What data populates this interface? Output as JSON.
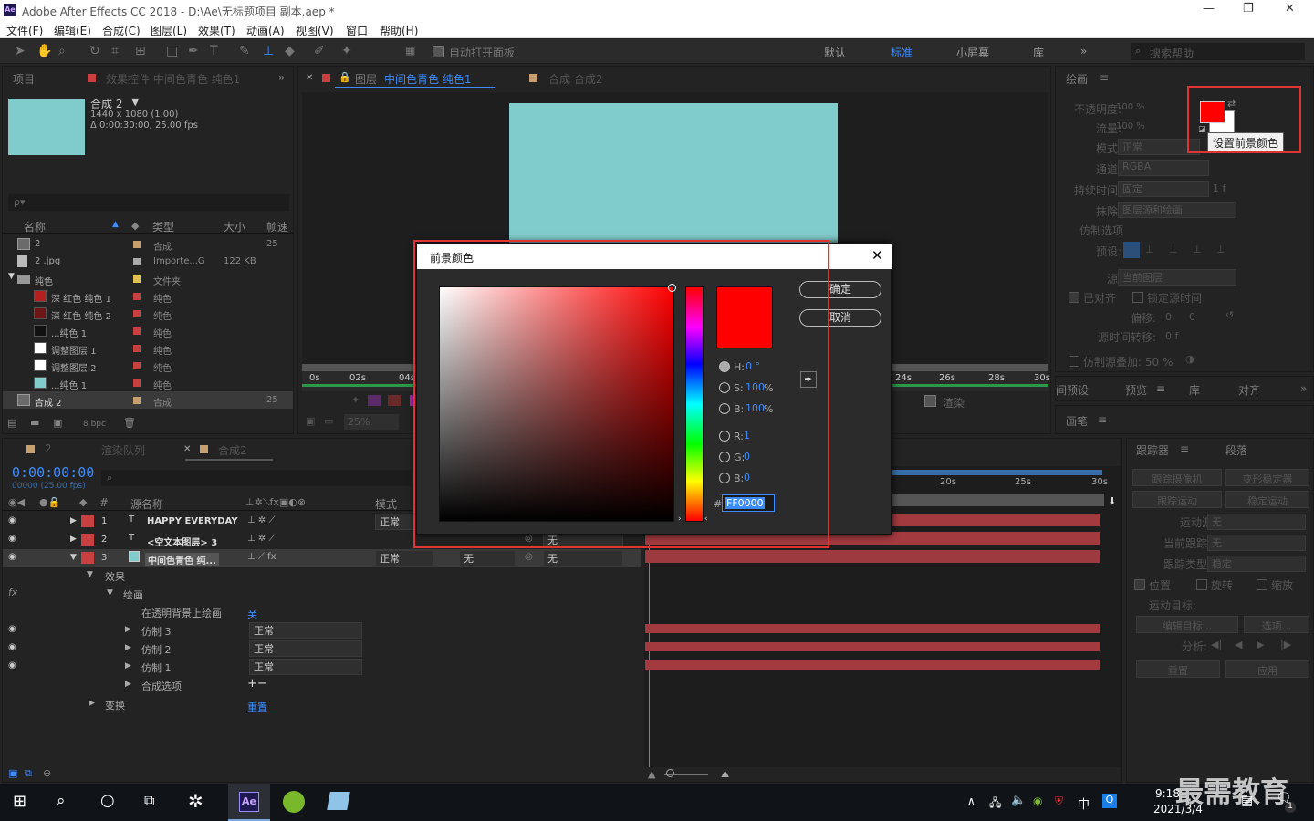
{
  "window": {
    "title": "Adobe After Effects CC 2018 - D:\\Ae\\无标题项目 副本.aep *",
    "logo": "Ae",
    "minimize": "—",
    "maximize": "❐",
    "close": "✕"
  },
  "menu": [
    "文件(F)",
    "编辑(E)",
    "合成(C)",
    "图层(L)",
    "效果(T)",
    "动画(A)",
    "视图(V)",
    "窗口",
    "帮助(H)"
  ],
  "toolbar": {
    "auto_open": "自动打开面板",
    "workspaces": [
      "默认",
      "标准",
      "小屏幕",
      "库"
    ],
    "search_placeholder": "搜索帮助"
  },
  "project_panel": {
    "tab_project": "项目",
    "tab_effects": "效果控件 中间色青色 纯色1",
    "comp_name": "合成 2",
    "comp_info1": "1440 x 1080 (1.00)",
    "comp_info2": "Δ 0:00:30:00, 25.00 fps",
    "search_placeholder": "ρ▾",
    "headers": {
      "name": "名称",
      "type": "类型",
      "size": "大小",
      "rate": "帧速"
    },
    "items": [
      {
        "name": "2",
        "type": "合成",
        "size": "",
        "rate": "25",
        "tag": "#c8a070",
        "swatch": "",
        "indent": 0,
        "icon": "comp"
      },
      {
        "name": "2 .jpg",
        "type": "Importe...G",
        "size": "122 KB",
        "rate": "",
        "tag": "#aaaaaa",
        "swatch": "",
        "indent": 0,
        "icon": "file"
      },
      {
        "name": "纯色",
        "type": "文件夹",
        "size": "",
        "rate": "",
        "tag": "#e0c050",
        "swatch": "",
        "indent": 0,
        "icon": "folder"
      },
      {
        "name": "深 红色 纯色 1",
        "type": "纯色",
        "size": "",
        "rate": "",
        "tag": "#c94040",
        "swatch": "#b22020",
        "indent": 1,
        "icon": "solid"
      },
      {
        "name": "深 红色 纯色 2",
        "type": "纯色",
        "size": "",
        "rate": "",
        "tag": "#c94040",
        "swatch": "#6e1515",
        "indent": 1,
        "icon": "solid"
      },
      {
        "name": "...纯色 1",
        "type": "纯色",
        "size": "",
        "rate": "",
        "tag": "#c94040",
        "swatch": "#111111",
        "indent": 1,
        "icon": "solid"
      },
      {
        "name": "调整图层 1",
        "type": "纯色",
        "size": "",
        "rate": "",
        "tag": "#c94040",
        "swatch": "#ffffff",
        "indent": 1,
        "icon": "solid"
      },
      {
        "name": "调整图层 2",
        "type": "纯色",
        "size": "",
        "rate": "",
        "tag": "#c94040",
        "swatch": "#ffffff",
        "indent": 1,
        "icon": "solid"
      },
      {
        "name": "...纯色 1",
        "type": "纯色",
        "size": "",
        "rate": "",
        "tag": "#c94040",
        "swatch": "#80cbcb",
        "indent": 1,
        "icon": "solid"
      },
      {
        "name": "合成 2",
        "type": "合成",
        "size": "",
        "rate": "25",
        "tag": "#c8a070",
        "swatch": "",
        "indent": 0,
        "icon": "comp"
      }
    ],
    "bpc": "8 bpc"
  },
  "viewer": {
    "tab_layer": "图层",
    "tab_layer_name": "中间色青色 纯色1",
    "tab_comp": "合成 合成2",
    "canvas_color": "#80cbcb",
    "ruler_left": [
      "0s",
      "02s",
      "04s"
    ],
    "ruler_right": [
      "24s",
      "26s",
      "28s",
      "30s"
    ],
    "zoom": "25%",
    "render_label": "渲染"
  },
  "paint_panel": {
    "title": "绘画",
    "opacity_label": "不透明度:",
    "opacity_val": "100 %",
    "flow_label": "流量:",
    "flow_val": "100 %",
    "mode_label": "模式:",
    "mode_val": "正常",
    "channel_label": "通道:",
    "channel_val": "RGBA",
    "duration_label": "持续时间:",
    "duration_val": "固定",
    "duration_suffix": "1 f",
    "erase_label": "抹除:",
    "erase_val": "图层源和绘画",
    "clone_opts": "仿制选项",
    "preset_label": "预设:",
    "source_label": "源:",
    "source_val": "当前图层",
    "aligned": "已对齐",
    "lock_time": "锁定源时间",
    "offset_label": "偏移:",
    "offset_x": "0,",
    "offset_y": "0",
    "time_shift_label": "源时间转移:",
    "time_shift_val": "0 f",
    "overlay": "仿制源叠加: 50 %",
    "fg_color": "#ff0000",
    "tooltip": "设置前景颜色",
    "tabs": [
      "间预设",
      "预览",
      "库",
      "对齐"
    ],
    "brush_tab": "画笔"
  },
  "dialog": {
    "title": "前景颜色",
    "ok": "确定",
    "cancel": "取消",
    "swatch_color": "#ff0000",
    "hsb": [
      {
        "label": "H:",
        "value": "0 °"
      },
      {
        "label": "S:",
        "value": "100",
        "unit": "%"
      },
      {
        "label": "B:",
        "value": "100",
        "unit": "%"
      }
    ],
    "rgb": [
      {
        "label": "R:",
        "value": "1"
      },
      {
        "label": "G:",
        "value": "0"
      },
      {
        "label": "B:",
        "value": "0"
      }
    ],
    "hex_label": "#",
    "hex_value": "FF0000"
  },
  "timeline": {
    "tab_comp2": "2",
    "tab_render": "渲染队列",
    "tab_active": "合成2",
    "timecode": "0:00:00:00",
    "timecode_sub": "00000 (25.00 fps)",
    "headers": {
      "num": "#",
      "name": "源名称",
      "mode": "模式"
    },
    "layers": [
      {
        "num": "1",
        "name": "HAPPY EVERYDAY",
        "mode": "正常",
        "kind": "T",
        "color": "#c94040"
      },
      {
        "num": "2",
        "name": "<空文本图层> 3",
        "mode": "",
        "kind": "T",
        "color": "#c94040"
      },
      {
        "num": "3",
        "name": "中间色青色 纯...",
        "mode": "正常",
        "kind": "solid",
        "color": "#c94040"
      }
    ],
    "trkmat_none": "无",
    "parent_none": "无",
    "effects": "效果",
    "paint": "绘画",
    "paint_on_trans": "在透明背景上绘画",
    "paint_on_trans_val": "关",
    "clones": [
      {
        "name": "仿制 3",
        "mode": "正常"
      },
      {
        "name": "仿制 2",
        "mode": "正常"
      },
      {
        "name": "仿制 1",
        "mode": "正常"
      }
    ],
    "composite": "合成选项",
    "composite_ctrl": "+−",
    "transform": "变换",
    "reset": "重置",
    "ruler": [
      "20s",
      "25s",
      "30s"
    ]
  },
  "tracker": {
    "tab": "跟踪器",
    "tab2": "段落",
    "track_camera": "跟踪摄像机",
    "warp_stab": "变形稳定器",
    "track_motion": "跟踪运动",
    "stabilize": "稳定运动",
    "motion_source_label": "运动源:",
    "motion_source_val": "无",
    "current_track_label": "当前跟踪:",
    "current_track_val": "无",
    "track_type_label": "跟踪类型:",
    "track_type_val": "稳定",
    "position": "位置",
    "rotation": "旋转",
    "scale": "缩放",
    "motion_target": "运动目标:",
    "edit_target": "编辑目标...",
    "options": "选项...",
    "analyze": "分析:",
    "reset": "重置",
    "apply": "应用"
  },
  "taskbar": {
    "time": "9:18",
    "date": "2021/3/4",
    "ime": "中",
    "watermark": "最需教育",
    "notif": "1"
  }
}
